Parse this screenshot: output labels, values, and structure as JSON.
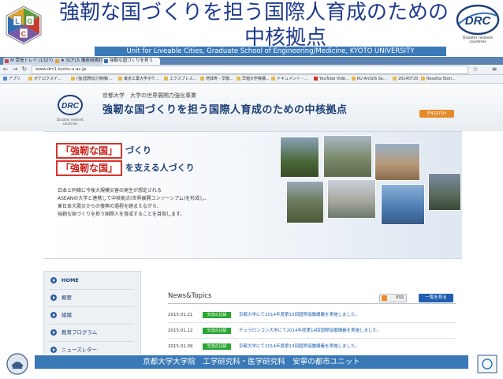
{
  "slide": {
    "title_line1": "強靭な国づくりを担う国際人育成のための",
    "title_line2": "中核拠点",
    "banner": "Unit for Liveable Cities, Graduate School of Engineering/Medicine, KYOTO UNIVERSITY",
    "logo_left_letters": [
      "L",
      "G",
      "C"
    ],
    "logo_right_text": "DRC",
    "logo_right_caption": "Disaster resilient countries",
    "footer": "京都大学大学院　工学研究科・医学研究科　安寧の都市ユニット"
  },
  "browser": {
    "tabs": [
      {
        "label": "M 受信トレイ (1327) - "
      },
      {
        "label": "★ SCF15 講座用検討 "
      },
      {
        "label": "強靭な国づくりを担う"
      }
    ],
    "url": "www.drc1.kyoto-u.ac.jp",
    "bookmarks": [
      "アプリ",
      "ボケロクスゲ...",
      "(独)国際協力機構(...",
      "東京工業大学ポケ...",
      "エクスプレス...",
      "地球寿 - 早都...",
      "早稲大学機構...",
      "ドキュメント - ...",
      "YouTube Vide...",
      "KU ArcGIS Se...",
      "20140720",
      "Rosetta Ston..."
    ]
  },
  "site": {
    "logo_text": "DRC",
    "logo_caption": "Disaster resilient countries",
    "subtitle": "京都大学　大学の世界展開力強化事業",
    "title": "強靭な国づくりを担う国際人育成のための中核拠点",
    "english_button": "ENGLISH",
    "hero": {
      "box1": "「強靭な国」",
      "after1": "づくり",
      "box2": "「強靭な国」",
      "after2": "を支える人づくり",
      "lines": [
        "日本と同様に今後大規模災害の発生が想定される",
        "ASEANの大学と連携して中核拠点(世界展開コンソーシアム)を形成し、",
        "東日本大震災からの復興の過程を踏まえながら、",
        "強靭な国づくりを担う国際人を育成することを目指します。"
      ]
    },
    "sidebar": [
      "HOME",
      "概要",
      "組織",
      "教育プログラム",
      "ニューズレター"
    ],
    "news": {
      "heading": "News&Topics",
      "rss_label": "RSS",
      "more_label": "一覧を見る",
      "items": [
        {
          "date": "2015.01.21",
          "tag": "交流の記録",
          "title": "京都大学にて2014年度第15回国際協働講義を実施しました。"
        },
        {
          "date": "2015.01.12",
          "tag": "交流の記録",
          "title": "チュラロンコン大学にて2014年度第14回国際協働講義を実施しました。"
        },
        {
          "date": "2015.01.09",
          "tag": "交流の記録",
          "title": "京都大学にて2014年度第13回国際協働講義を実施しました。"
        }
      ]
    }
  },
  "colors": {
    "title_blue": "#1f3b8c",
    "banner_blue": "#3a79b8",
    "hero_red": "#d8342b",
    "tag_green": "#2aa532",
    "link_blue": "#1f5fb0",
    "english_orange": "#e58a28"
  }
}
